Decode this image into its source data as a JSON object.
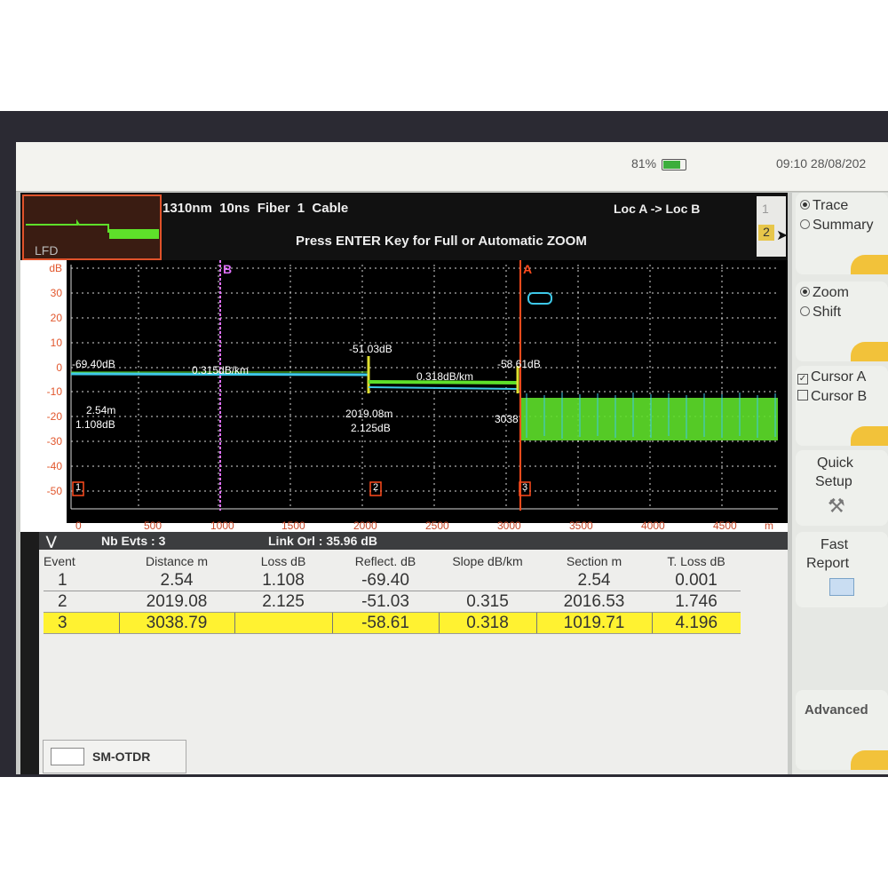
{
  "status": {
    "battery_pct": "81%",
    "clock": "09:10  28/08/202"
  },
  "header": {
    "lfd_label": "LFD",
    "title": "1310nm  10ns  Fiber  1  Cable",
    "loc": "Loc A -> Loc B",
    "hint": "Press ENTER Key for Full or Automatic ZOOM",
    "page_tabs": [
      "1",
      "2"
    ]
  },
  "plot": {
    "y_unit": "dB",
    "y_ticks": [
      "30",
      "20",
      "10",
      "0",
      "-10",
      "-20",
      "-30",
      "-40",
      "-50"
    ],
    "x_ticks": [
      "0",
      "500",
      "1000",
      "1500",
      "2000",
      "2500",
      "3000",
      "3500",
      "4000",
      "4500"
    ],
    "x_unit": "m",
    "cursor_b_label": "B",
    "cursor_a_label": "A",
    "annotations": {
      "ev1_reflect": "-69.40dB",
      "ev1_dist": "2.54m",
      "ev1_loss": "1.108dB",
      "slope1": "0.315dB/km",
      "ev2_reflect": "-51.03dB",
      "ev2_dist": "2019.08m",
      "ev2_loss": "2.125dB",
      "slope2": "0.318dB/km",
      "ev3_reflect": "-58.61dB",
      "ev3_dist": "3038"
    },
    "markers": [
      "1",
      "2",
      "3"
    ]
  },
  "summary_bar": {
    "nb_evts": "Nb Evts : 3",
    "link_orl": "Link Orl :  35.96 dB"
  },
  "table": {
    "headers": [
      "Event",
      "Distance  m",
      "Loss dB",
      "Reflect. dB",
      "Slope  dB/km",
      "Section m",
      "T. Loss dB"
    ],
    "rows": [
      {
        "event": "1",
        "distance": "2.54",
        "loss": "1.108",
        "reflect": "-69.40",
        "slope": "",
        "section": "2.54",
        "tloss": "0.001"
      },
      {
        "event": "2",
        "distance": "2019.08",
        "loss": "2.125",
        "reflect": "-51.03",
        "slope": "0.315",
        "section": "2016.53",
        "tloss": "1.746"
      },
      {
        "event": "3",
        "distance": "3038.79",
        "loss": "",
        "reflect": "-58.61",
        "slope": "0.318",
        "section": "1019.71",
        "tloss": "4.196"
      }
    ]
  },
  "sidebar": {
    "trace": "Trace",
    "summary": "Summary",
    "zoom": "Zoom",
    "shift": "Shift",
    "cursor_a": "Cursor A",
    "cursor_b": "Cursor B",
    "quick_setup_1": "Quick",
    "quick_setup_2": "Setup",
    "fast_report_1": "Fast",
    "fast_report_2": "Report",
    "advanced": "Advanced"
  },
  "bottom_tab": {
    "label": "SM-OTDR"
  },
  "colors": {
    "trace_blue": "#3ec8e8",
    "trace_green": "#5ee02a",
    "cursor_a": "#ff4a1c",
    "cursor_b": "#e070ff",
    "highlight": "#fff231"
  }
}
